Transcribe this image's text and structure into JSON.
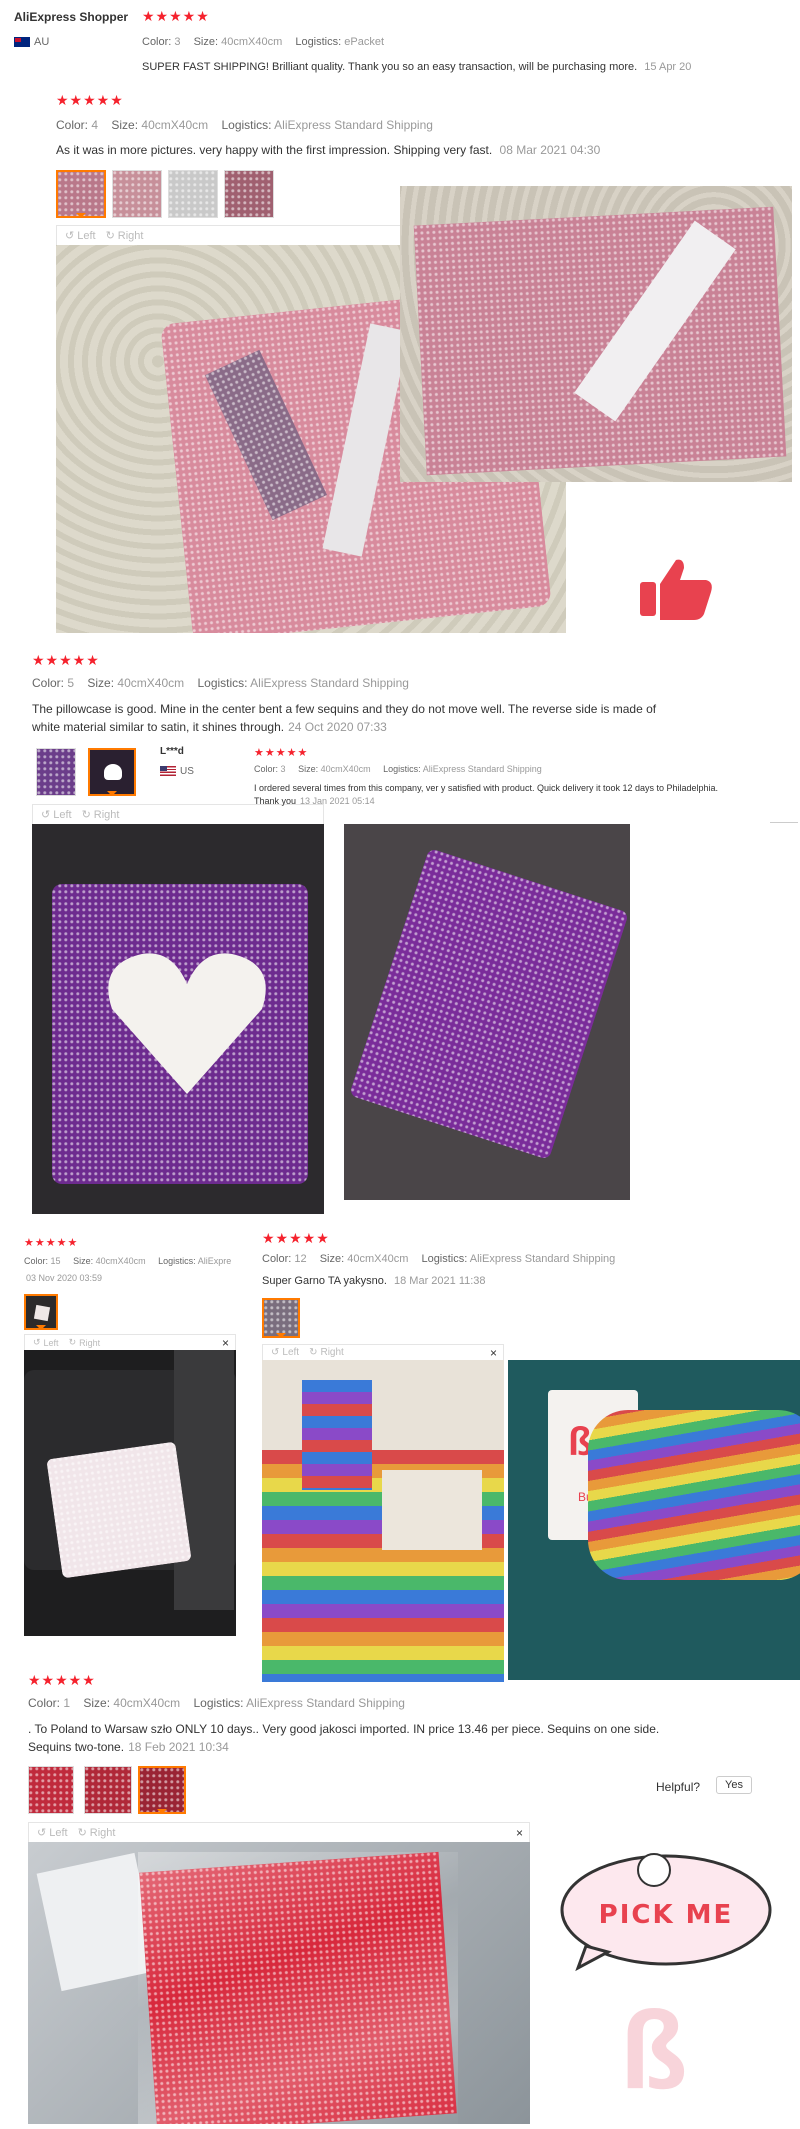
{
  "review1": {
    "buyer": "AliExpress Shopper",
    "country": "AU",
    "stars": "★★★★★",
    "color_label": "Color:",
    "color_value": "3",
    "size_label": "Size:",
    "size_value": "40cmX40cm",
    "logistics_label": "Logistics:",
    "logistics_value": "ePacket",
    "text": "SUPER FAST SHIPPING! Brilliant quality. Thank you so an easy transaction, will be purchasing more.",
    "date": "15 Apr 20"
  },
  "review2": {
    "stars": "★★★★★",
    "color_label": "Color:",
    "color_value": "4",
    "size_label": "Size:",
    "size_value": "40cmX40cm",
    "logistics_label": "Logistics:",
    "logistics_value": "AliExpress Standard Shipping",
    "text": "As it was in more pictures. very happy with the first impression. Shipping very fast.",
    "date": "08 Mar 2021 04:30",
    "left": "Left",
    "right": "Right"
  },
  "review3": {
    "stars": "★★★★★",
    "color_label": "Color:",
    "color_value": "5",
    "size_label": "Size:",
    "size_value": "40cmX40cm",
    "logistics_label": "Logistics:",
    "logistics_value": "AliExpress Standard Shipping",
    "text1": "The pillowcase is good. Mine in the center bent a few sequins and they do not move well. The reverse side is made of",
    "text2": "white material similar to satin, it shines through.",
    "date": "24 Oct 2020 07:33",
    "left": "Left",
    "right": "Right"
  },
  "review4": {
    "buyer": "L***d",
    "country": "US",
    "stars": "★★★★★",
    "color_label": "Color:",
    "color_value": "3",
    "size_label": "Size:",
    "size_value": "40cmX40cm",
    "logistics_label": "Logistics:",
    "logistics_value": "AliExpress Standard Shipping",
    "text1": "I ordered several times from this company, ver y satisfied with product. Quick delivery it took 12 days to Philadelphia.",
    "text2": "Thank you",
    "date": "13 Jan 2021 05:14"
  },
  "review5": {
    "stars": "★★★★★",
    "color_label": "Color:",
    "color_value": "15",
    "size_label": "Size:",
    "size_value": "40cmX40cm",
    "logistics_label": "Logistics:",
    "logistics_value": "AliExpre",
    "date": "03 Nov 2020 03:59",
    "left": "Left",
    "right": "Right",
    "close": "×"
  },
  "review6": {
    "stars": "★★★★★",
    "color_label": "Color:",
    "color_value": "12",
    "size_label": "Size:",
    "size_value": "40cmX40cm",
    "logistics_label": "Logistics:",
    "logistics_value": "AliExpress Standard Shipping",
    "text": "Super Garno TA yakysno.",
    "date": "18 Mar 2021 11:38",
    "left": "Left",
    "right": "Right",
    "close": "×",
    "card_text": "Bubt"
  },
  "review7": {
    "stars": "★★★★★",
    "color_label": "Color:",
    "color_value": "1",
    "size_label": "Size:",
    "size_value": "40cmX40cm",
    "logistics_label": "Logistics:",
    "logistics_value": "AliExpress Standard Shipping",
    "text1": ". To Poland to Warsaw szło ONLY 10 days.. Very good jakosci imported. IN price 13.46 per piece. Sequins on one side.",
    "text2": "Sequins two-tone.",
    "date": "18 Feb 2021 10:34",
    "helpful": "Helpful?",
    "yes": "Yes",
    "left": "Left",
    "right": "Right",
    "close": "×"
  },
  "sticker": {
    "text": "PICK ME"
  },
  "colors": {
    "star": "#f5222d",
    "accent": "#ff7a00",
    "thumb": "#e8424f"
  }
}
